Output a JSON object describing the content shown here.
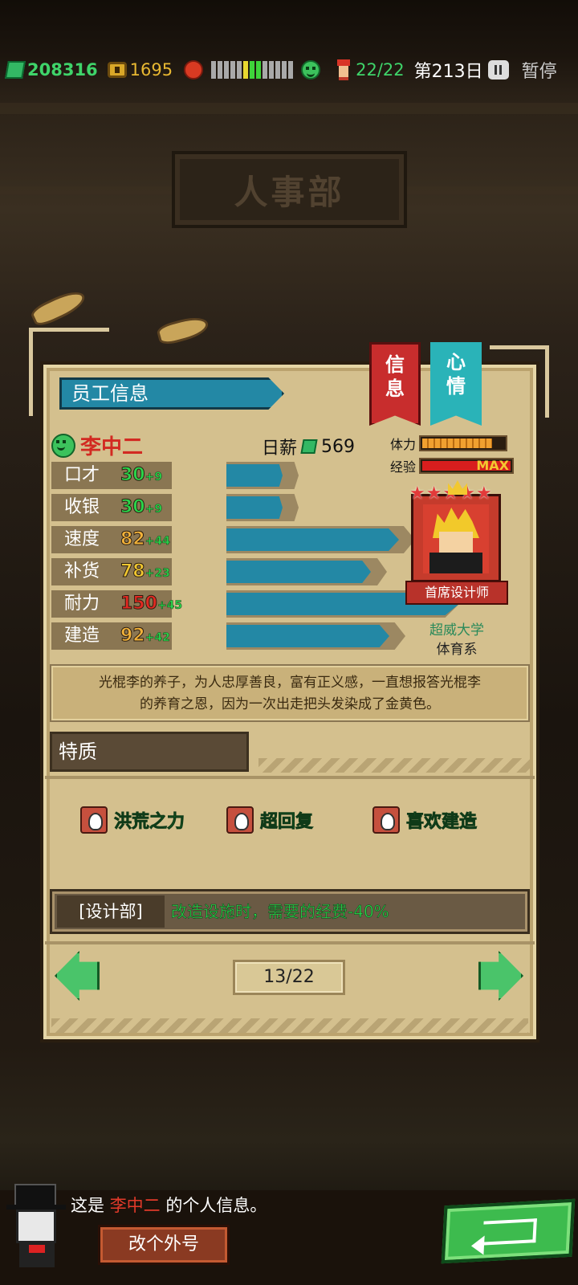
{
  "status_bar": {
    "money": "208316",
    "coins": "1695",
    "mood_levels": [
      "gray",
      "gray",
      "gray",
      "gray",
      "gray",
      "yellow",
      "green",
      "green",
      "gray",
      "gray",
      "gray",
      "gray",
      "gray"
    ],
    "staff_count": "22/22",
    "day": "第213日",
    "pause_label": "暂停"
  },
  "background": {
    "sign_text": "人事部"
  },
  "panel": {
    "title": "员工信息",
    "tabs": [
      {
        "label": "信\n息",
        "active": true
      },
      {
        "label": "心\n情",
        "active": false
      }
    ]
  },
  "employee": {
    "name": "李中二",
    "wage_label": "日薪",
    "wage_value": "569",
    "stamina_label": "体力",
    "stamina_level": 0.85,
    "exp_label": "经验",
    "exp_value": "MAX",
    "role": "首席设计师",
    "university": "超威大学",
    "major": "体育系",
    "stars": 5,
    "stats": [
      {
        "label": "口才",
        "base": "30",
        "bonus": "+9",
        "color": "#2ad44a",
        "bar_pct": 0.24
      },
      {
        "label": "收银",
        "base": "30",
        "bonus": "+9",
        "color": "#2ad44a",
        "bar_pct": 0.24
      },
      {
        "label": "速度",
        "base": "82",
        "bonus": "+44",
        "color": "#f2b23a",
        "bar_pct": 0.74
      },
      {
        "label": "补货",
        "base": "78",
        "bonus": "+23",
        "color": "#f2c830",
        "bar_pct": 0.62
      },
      {
        "label": "耐力",
        "base": "150",
        "bonus": "+45",
        "color": "#e02a22",
        "bar_pct": 1.0
      },
      {
        "label": "建造",
        "base": "92",
        "bonus": "+42",
        "color": "#f2b23a",
        "bar_pct": 0.7
      }
    ],
    "description_line1": "光棍李的养子，为人忠厚善良，富有正义感，一直想报答光棍李",
    "description_line2": "的养育之恩，因为一次出走把头发染成了金黄色。"
  },
  "traits": {
    "heading": "特质",
    "items": [
      "洪荒之力",
      "超回复",
      "喜欢建造"
    ]
  },
  "department": {
    "tag": "[设计部]",
    "effect": "改造设施时，需要的经费-40%"
  },
  "pager": {
    "text": "13/22"
  },
  "footer": {
    "dialog_prefix": "这是",
    "dialog_name": "李中二",
    "dialog_suffix": "的个人信息。",
    "nickname_button": "改个外号"
  }
}
